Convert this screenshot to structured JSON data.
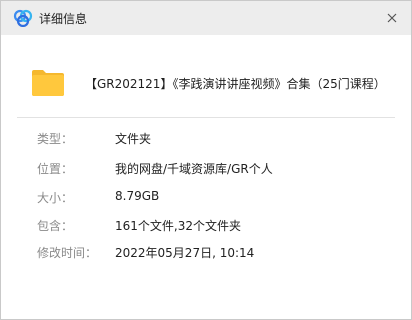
{
  "window": {
    "title": "详细信息"
  },
  "file": {
    "name": "【GR202121】《李践演讲讲座视频》合集（25门课程）"
  },
  "properties": [
    {
      "label": "类型：",
      "value": "文件夹"
    },
    {
      "label": "位置：",
      "value": "我的网盘/千域资源库/GR个人"
    },
    {
      "label": "大小：",
      "value": "8.79GB"
    },
    {
      "label": "包含：",
      "value": "161个文件,32个文件夹"
    },
    {
      "label": "修改时间：",
      "value": "2022年05月27日, 10:14"
    }
  ],
  "colors": {
    "titlebar": "#ededed",
    "folder": "#ffc83d",
    "logo_blue": "#3c8cf0"
  }
}
